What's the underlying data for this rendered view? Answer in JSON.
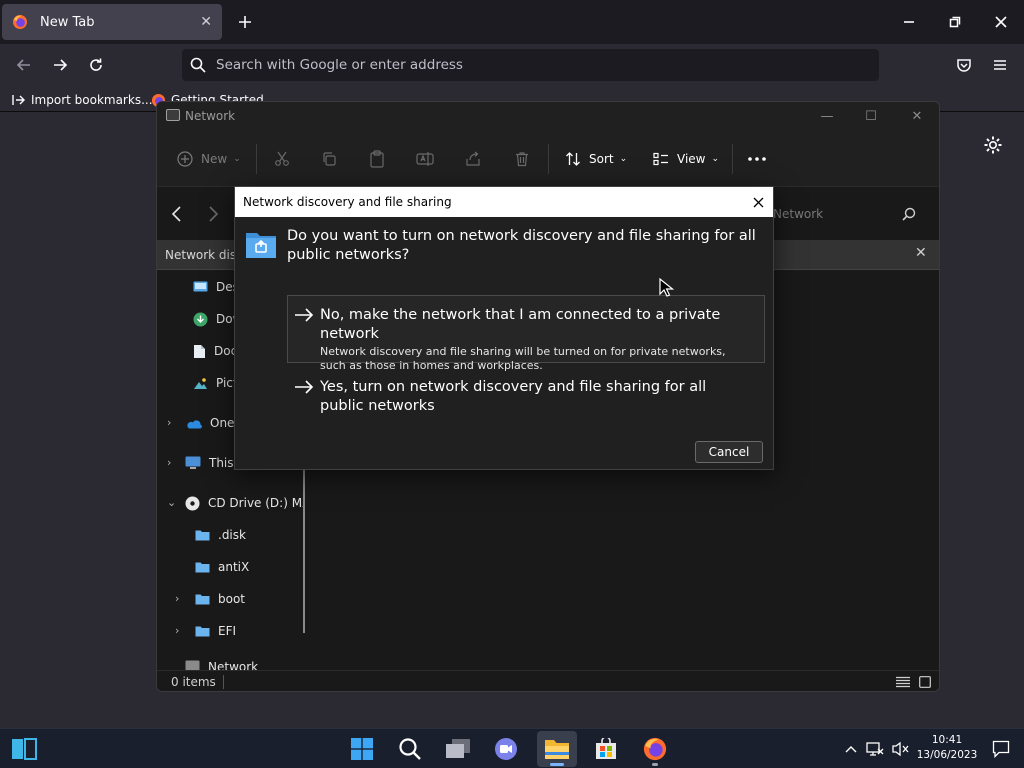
{
  "browser": {
    "tab_title": "New Tab",
    "url_placeholder": "Search with Google or enter address",
    "bookmarks": [
      {
        "label": "Import bookmarks...",
        "icon": "import-icon"
      },
      {
        "label": "Getting Started",
        "icon": "firefox-icon"
      }
    ]
  },
  "explorer": {
    "title": "Network",
    "toolbar": {
      "new_label": "New",
      "sort_label": "Sort",
      "view_label": "View"
    },
    "search_placeholder": "Network",
    "infobar_text": "Network discovery is turned off.",
    "nav_items": [
      {
        "label": "Desktop",
        "icon": "desktop-icon"
      },
      {
        "label": "Downloads",
        "icon": "download-icon"
      },
      {
        "label": "Documents",
        "icon": "document-icon"
      },
      {
        "label": "Pictures",
        "icon": "pictures-icon"
      },
      {
        "label": "OneDrive",
        "icon": "onedrive-icon"
      },
      {
        "label": "This PC",
        "icon": "pc-icon"
      },
      {
        "label": "CD Drive (D:) MX",
        "icon": "cd-drive-icon"
      },
      {
        "label": ".disk",
        "icon": "folder-icon"
      },
      {
        "label": "antiX",
        "icon": "folder-icon"
      },
      {
        "label": "boot",
        "icon": "folder-icon"
      },
      {
        "label": "EFI",
        "icon": "folder-icon"
      },
      {
        "label": "Network",
        "icon": "network-icon"
      }
    ],
    "status_items": "0 items"
  },
  "dialog": {
    "title": "Network discovery and file sharing",
    "question": "Do you want to turn on network discovery and file sharing for all public networks?",
    "options": [
      {
        "title": "No, make the network that I am connected to a private network",
        "description": "Network discovery and file sharing will be turned on for private networks, such as those in homes and workplaces."
      },
      {
        "title": "Yes, turn on network discovery and file sharing for all public networks",
        "description": ""
      }
    ],
    "cancel_label": "Cancel"
  },
  "taskbar": {
    "time": "10:41",
    "date": "13/06/2023"
  },
  "colors": {
    "accent": "#4cc2ff",
    "folder": "#6cb4ee",
    "taskbar_bg": "#1a1f2e"
  }
}
